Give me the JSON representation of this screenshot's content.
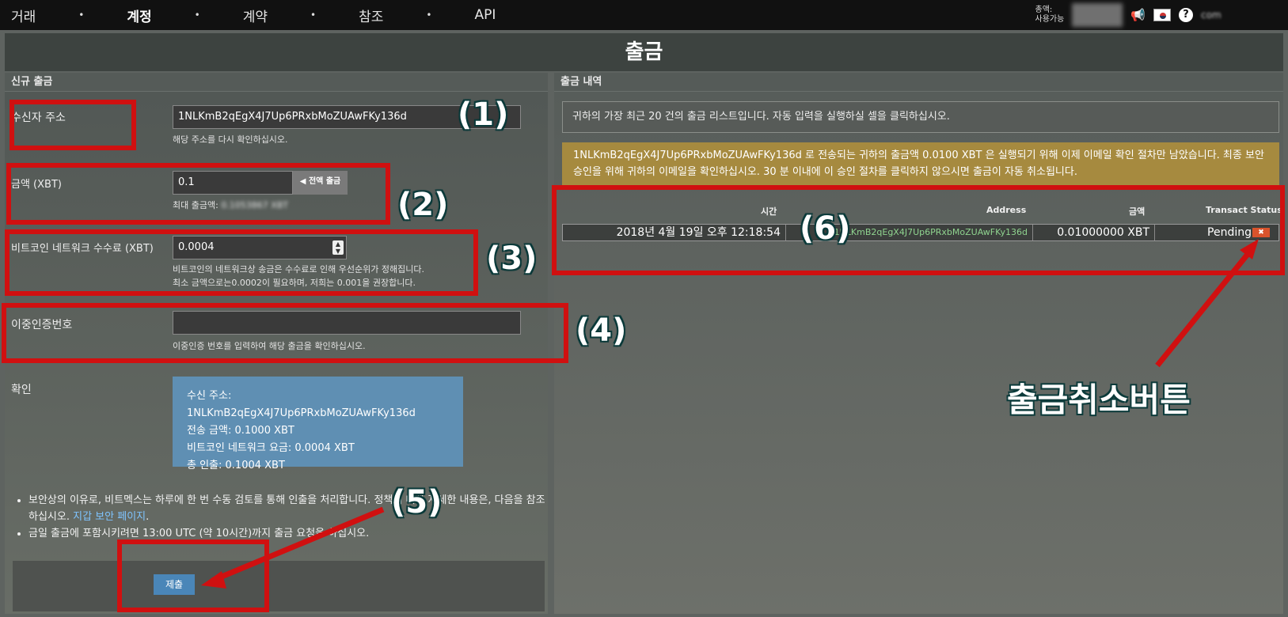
{
  "nav": {
    "items": [
      "거래",
      "계정",
      "계약",
      "참조",
      "API"
    ],
    "balance_label_1": "총액:",
    "balance_label_2": "사용가능",
    "account_name": "com",
    "icons": [
      "megaphone-icon",
      "korean-flag-icon",
      "help-icon"
    ]
  },
  "page": {
    "title": "출금"
  },
  "left": {
    "header": "신규 출금",
    "address_label": "수신자 주소",
    "address_value": "1NLKmB2qEgX4J7Up6PRxbMoZUAwFKy136d",
    "address_help": "해당 주소를 다시 확인하십시오.",
    "amount_label": "금액 (XBT)",
    "amount_value": "0.1",
    "all_button": "전액 출금",
    "max_label": "최대 출금액:",
    "max_value": "0.1053867 XBT",
    "fee_label": "비트코인 네트워크 수수료 (XBT)",
    "fee_value": "0.0004",
    "fee_help_1": "비트코인의 네트워크상 송금은 수수료로 인해 우선순위가 정해집니다.",
    "fee_help_2": "최소 금액으로는0.0002이 필요하며, 저희는 0.001을 권장합니다.",
    "otp_label": "이중인증번호",
    "otp_value": "",
    "otp_help": "이중인증 번호를 입력하여 해당 출금을 확인하십시오.",
    "confirm_label": "확인",
    "confirm": {
      "address_label": "수신 주소:",
      "address_value": "1NLKmB2qEgX4J7Up6PRxbMoZUAwFKy136d",
      "amount": "전송 금액: 0.1000 XBT",
      "fee": "비트코인 네트워크 요금: 0.0004 XBT",
      "total": "총 인출: 0.1004 XBT"
    },
    "notes": [
      "보안상의 이유로, 비트멕스는 하루에 한 번 수동 검토를 통해 인출을 처리합니다. 정책에 대한 자세한 내용은, 다음을 참조하십시오.",
      "금일 출금에 포함시키려면 13:00 UTC (약 10시간)까지 출금 요청을 하십시오."
    ],
    "notes_link": "지갑 보안 페이지",
    "submit": "제출"
  },
  "right": {
    "header": "출금 내역",
    "info": "귀하의 가장 최근 20 건의 출금 리스트입니다. 자동 입력을 실행하실 셀을 클릭하십시오.",
    "warning": "1NLKmB2qEgX4J7Up6PRxbMoZUAwFKy136d 로 전송되는 귀하의 출금액 0.0100 XBT 은 실행되기 위해 이제 이메일 확인 절차만 남았습니다. 최종 보안 승인을 위해 귀하의 이메일을 확인하십시오. 30 분 이내에 이 승인 절차를 클릭하지 않으시면 출금이 자동 취소됩니다.",
    "columns": [
      "시간",
      "Address",
      "금액",
      "Transact Status"
    ],
    "row": {
      "time": "2018년 4월 19일 오후 12:18:54",
      "address": "1NLKmB2qEgX4J7Up6PRxbMoZUAwFKy136d",
      "amount": "0.01000000 XBT",
      "status": "Pending",
      "cancel": "✖"
    }
  },
  "annotations": {
    "n1": "(1)",
    "n2": "(2)",
    "n3": "(3)",
    "n4": "(4)",
    "n5": "(5)",
    "n6": "(6)",
    "cancel_label": "출금취소버튼",
    "color": "#d01010"
  }
}
